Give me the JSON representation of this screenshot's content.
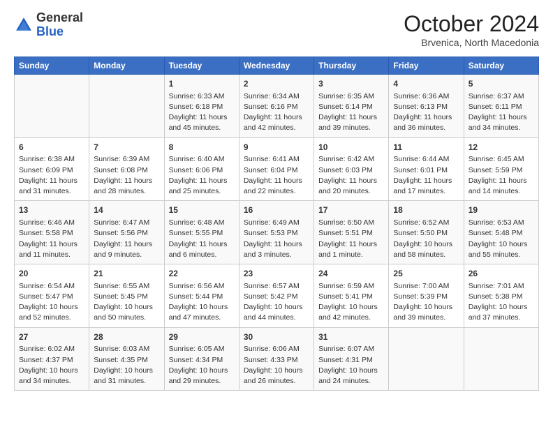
{
  "logo": {
    "general": "General",
    "blue": "Blue"
  },
  "title": "October 2024",
  "subtitle": "Brvenica, North Macedonia",
  "days_of_week": [
    "Sunday",
    "Monday",
    "Tuesday",
    "Wednesday",
    "Thursday",
    "Friday",
    "Saturday"
  ],
  "weeks": [
    [
      {
        "day": "",
        "info": ""
      },
      {
        "day": "",
        "info": ""
      },
      {
        "day": "1",
        "info": "Sunrise: 6:33 AM\nSunset: 6:18 PM\nDaylight: 11 hours and 45 minutes."
      },
      {
        "day": "2",
        "info": "Sunrise: 6:34 AM\nSunset: 6:16 PM\nDaylight: 11 hours and 42 minutes."
      },
      {
        "day": "3",
        "info": "Sunrise: 6:35 AM\nSunset: 6:14 PM\nDaylight: 11 hours and 39 minutes."
      },
      {
        "day": "4",
        "info": "Sunrise: 6:36 AM\nSunset: 6:13 PM\nDaylight: 11 hours and 36 minutes."
      },
      {
        "day": "5",
        "info": "Sunrise: 6:37 AM\nSunset: 6:11 PM\nDaylight: 11 hours and 34 minutes."
      }
    ],
    [
      {
        "day": "6",
        "info": "Sunrise: 6:38 AM\nSunset: 6:09 PM\nDaylight: 11 hours and 31 minutes."
      },
      {
        "day": "7",
        "info": "Sunrise: 6:39 AM\nSunset: 6:08 PM\nDaylight: 11 hours and 28 minutes."
      },
      {
        "day": "8",
        "info": "Sunrise: 6:40 AM\nSunset: 6:06 PM\nDaylight: 11 hours and 25 minutes."
      },
      {
        "day": "9",
        "info": "Sunrise: 6:41 AM\nSunset: 6:04 PM\nDaylight: 11 hours and 22 minutes."
      },
      {
        "day": "10",
        "info": "Sunrise: 6:42 AM\nSunset: 6:03 PM\nDaylight: 11 hours and 20 minutes."
      },
      {
        "day": "11",
        "info": "Sunrise: 6:44 AM\nSunset: 6:01 PM\nDaylight: 11 hours and 17 minutes."
      },
      {
        "day": "12",
        "info": "Sunrise: 6:45 AM\nSunset: 5:59 PM\nDaylight: 11 hours and 14 minutes."
      }
    ],
    [
      {
        "day": "13",
        "info": "Sunrise: 6:46 AM\nSunset: 5:58 PM\nDaylight: 11 hours and 11 minutes."
      },
      {
        "day": "14",
        "info": "Sunrise: 6:47 AM\nSunset: 5:56 PM\nDaylight: 11 hours and 9 minutes."
      },
      {
        "day": "15",
        "info": "Sunrise: 6:48 AM\nSunset: 5:55 PM\nDaylight: 11 hours and 6 minutes."
      },
      {
        "day": "16",
        "info": "Sunrise: 6:49 AM\nSunset: 5:53 PM\nDaylight: 11 hours and 3 minutes."
      },
      {
        "day": "17",
        "info": "Sunrise: 6:50 AM\nSunset: 5:51 PM\nDaylight: 11 hours and 1 minute."
      },
      {
        "day": "18",
        "info": "Sunrise: 6:52 AM\nSunset: 5:50 PM\nDaylight: 10 hours and 58 minutes."
      },
      {
        "day": "19",
        "info": "Sunrise: 6:53 AM\nSunset: 5:48 PM\nDaylight: 10 hours and 55 minutes."
      }
    ],
    [
      {
        "day": "20",
        "info": "Sunrise: 6:54 AM\nSunset: 5:47 PM\nDaylight: 10 hours and 52 minutes."
      },
      {
        "day": "21",
        "info": "Sunrise: 6:55 AM\nSunset: 5:45 PM\nDaylight: 10 hours and 50 minutes."
      },
      {
        "day": "22",
        "info": "Sunrise: 6:56 AM\nSunset: 5:44 PM\nDaylight: 10 hours and 47 minutes."
      },
      {
        "day": "23",
        "info": "Sunrise: 6:57 AM\nSunset: 5:42 PM\nDaylight: 10 hours and 44 minutes."
      },
      {
        "day": "24",
        "info": "Sunrise: 6:59 AM\nSunset: 5:41 PM\nDaylight: 10 hours and 42 minutes."
      },
      {
        "day": "25",
        "info": "Sunrise: 7:00 AM\nSunset: 5:39 PM\nDaylight: 10 hours and 39 minutes."
      },
      {
        "day": "26",
        "info": "Sunrise: 7:01 AM\nSunset: 5:38 PM\nDaylight: 10 hours and 37 minutes."
      }
    ],
    [
      {
        "day": "27",
        "info": "Sunrise: 6:02 AM\nSunset: 4:37 PM\nDaylight: 10 hours and 34 minutes."
      },
      {
        "day": "28",
        "info": "Sunrise: 6:03 AM\nSunset: 4:35 PM\nDaylight: 10 hours and 31 minutes."
      },
      {
        "day": "29",
        "info": "Sunrise: 6:05 AM\nSunset: 4:34 PM\nDaylight: 10 hours and 29 minutes."
      },
      {
        "day": "30",
        "info": "Sunrise: 6:06 AM\nSunset: 4:33 PM\nDaylight: 10 hours and 26 minutes."
      },
      {
        "day": "31",
        "info": "Sunrise: 6:07 AM\nSunset: 4:31 PM\nDaylight: 10 hours and 24 minutes."
      },
      {
        "day": "",
        "info": ""
      },
      {
        "day": "",
        "info": ""
      }
    ]
  ]
}
